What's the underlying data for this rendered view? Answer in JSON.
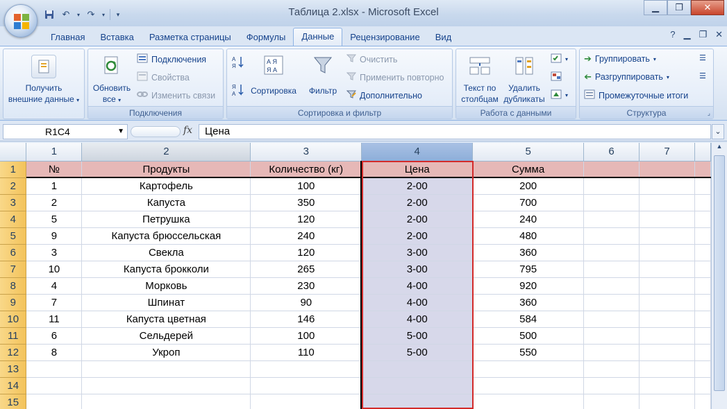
{
  "window": {
    "title": "Таблица 2.xlsx - Microsoft Excel"
  },
  "ribbon_tabs": [
    "Главная",
    "Вставка",
    "Разметка страницы",
    "Формулы",
    "Данные",
    "Рецензирование",
    "Вид"
  ],
  "active_tab": "Данные",
  "groups": {
    "external": {
      "btn_line1": "Получить",
      "btn_line2": "внешние данные"
    },
    "connections": {
      "label": "Подключения",
      "refresh_line1": "Обновить",
      "refresh_line2": "все",
      "connections": "Подключения",
      "properties": "Свойства",
      "edit_links": "Изменить связи"
    },
    "sort_filter": {
      "label": "Сортировка и фильтр",
      "sort": "Сортировка",
      "filter": "Фильтр",
      "clear": "Очистить",
      "reapply": "Применить повторно",
      "advanced": "Дополнительно"
    },
    "data_tools": {
      "label": "Работа с данными",
      "text_to_cols_line1": "Текст по",
      "text_to_cols_line2": "столбцам",
      "remove_dup_line1": "Удалить",
      "remove_dup_line2": "дубликаты"
    },
    "outline": {
      "label": "Структура",
      "group": "Группировать",
      "ungroup": "Разгруппировать",
      "subtotal": "Промежуточные итоги"
    }
  },
  "formula_bar": {
    "name_box": "R1C4",
    "fx": "fx",
    "formula": "Цена"
  },
  "columns": [
    "1",
    "2",
    "3",
    "4",
    "5",
    "6",
    "7"
  ],
  "header_row": [
    "№",
    "Продукты",
    "Количество (кг)",
    "Цена",
    "Сумма",
    "",
    ""
  ],
  "rows": [
    [
      "1",
      "Картофель",
      "100",
      "2-00",
      "200"
    ],
    [
      "2",
      "Капуста",
      "350",
      "2-00",
      "700"
    ],
    [
      "5",
      "Петрушка",
      "120",
      "2-00",
      "240"
    ],
    [
      "9",
      "Капуста брюссельская",
      "240",
      "2-00",
      "480"
    ],
    [
      "3",
      "Свекла",
      "120",
      "3-00",
      "360"
    ],
    [
      "10",
      "Капуста брокколи",
      "265",
      "3-00",
      "795"
    ],
    [
      "4",
      "Морковь",
      "230",
      "4-00",
      "920"
    ],
    [
      "7",
      "Шпинат",
      "90",
      "4-00",
      "360"
    ],
    [
      "11",
      "Капуста цветная",
      "146",
      "4-00",
      "584"
    ],
    [
      "6",
      "Сельдерей",
      "100",
      "5-00",
      "500"
    ],
    [
      "8",
      "Укроп",
      "110",
      "5-00",
      "550"
    ],
    [
      "",
      "",
      "",
      "",
      ""
    ],
    [
      "",
      "",
      "",
      "",
      ""
    ],
    [
      "",
      "",
      "",
      "",
      ""
    ]
  ],
  "row_numbers": [
    "1",
    "2",
    "3",
    "4",
    "5",
    "6",
    "7",
    "8",
    "9",
    "10",
    "11",
    "12",
    "13",
    "14",
    "15"
  ],
  "colors": {
    "selection_border": "#d32a2a",
    "header_fill": "#e6b8b7",
    "selected_col_fill": "#d7d8ea",
    "row_header": "#f3c35b"
  }
}
